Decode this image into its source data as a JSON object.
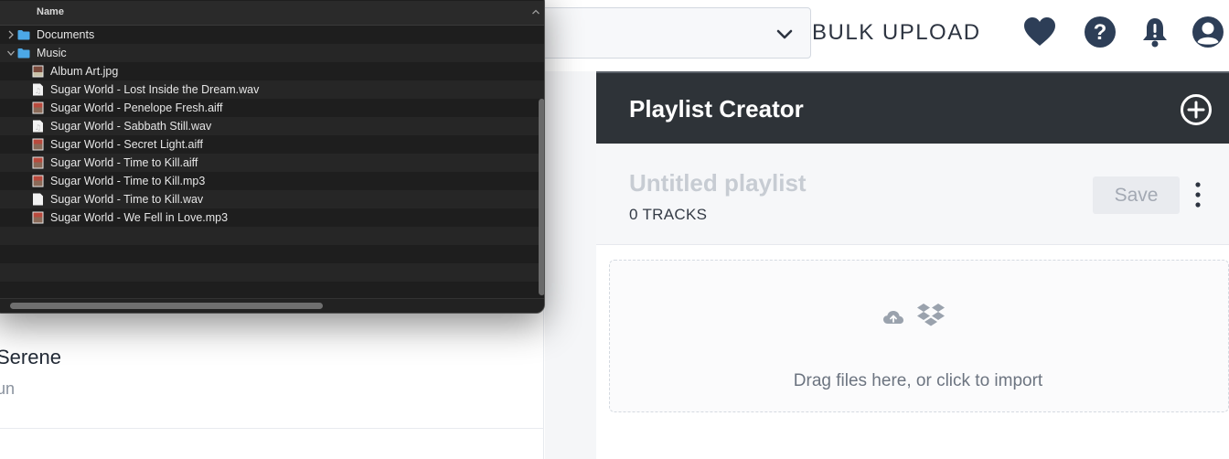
{
  "topbar": {
    "bulk_upload_label": "BULK UPLOAD",
    "icons": [
      "chevron-down-icon",
      "heart-icon",
      "help-icon",
      "bell-icon",
      "user-icon"
    ]
  },
  "left": {
    "track_title": "Serene",
    "track_subtitle": "un"
  },
  "playlist_creator": {
    "title": "Playlist Creator",
    "playlist_name": "Untitled playlist",
    "track_count": "0 TRACKS",
    "save_label": "Save",
    "drop_text": "Drag files here, or click to import",
    "header_bg": "#2e3338",
    "icons": [
      "add-circle-icon",
      "more-vertical-icon",
      "cloud-upload-icon",
      "dropbox-icon"
    ]
  },
  "finder": {
    "column_name": "Name",
    "rows": [
      {
        "label": "Documents",
        "kind": "folder",
        "expanded": false
      },
      {
        "label": "Music",
        "kind": "folder",
        "expanded": true
      },
      {
        "label": "Album Art.jpg",
        "kind": "image"
      },
      {
        "label": "Sugar World - Lost Inside the Dream.wav",
        "kind": "audio"
      },
      {
        "label": "Sugar World - Penelope Fresh.aiff",
        "kind": "image"
      },
      {
        "label": "Sugar World - Sabbath Still.wav",
        "kind": "audio"
      },
      {
        "label": "Sugar World - Secret Light.aiff",
        "kind": "image"
      },
      {
        "label": "Sugar World - Time to Kill.aiff",
        "kind": "image"
      },
      {
        "label": "Sugar World - Time to Kill.mp3",
        "kind": "image"
      },
      {
        "label": "Sugar World - Time to Kill.wav",
        "kind": "audio"
      },
      {
        "label": "Sugar World - We Fell in Love.mp3",
        "kind": "image"
      }
    ]
  }
}
